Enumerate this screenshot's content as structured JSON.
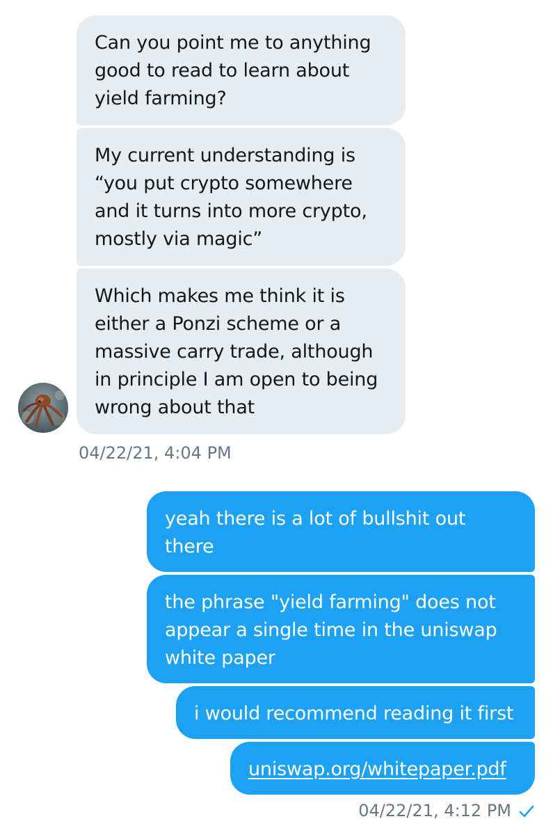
{
  "conversation": {
    "incoming": {
      "avatar_icon": "octopus-avatar",
      "messages": [
        {
          "lines": [
            "Can you point me to anything",
            "good to read to learn about",
            "yield farming?"
          ]
        },
        {
          "lines": [
            "My current understanding is",
            "“you put crypto somewhere",
            "and it turns into more crypto,",
            "mostly via magic”"
          ]
        },
        {
          "lines": [
            "Which makes me think it is",
            "either a Ponzi scheme or a",
            "massive carry trade, although",
            "in principle I am open to being",
            "wrong about that"
          ]
        }
      ],
      "timestamp": "04/22/21, 4:04 PM"
    },
    "outgoing": {
      "messages": [
        {
          "lines": [
            "yeah there is a lot of bullshit out",
            "there"
          ]
        },
        {
          "lines": [
            "the phrase \"yield farming\" does not",
            "appear a single time in the uniswap",
            "white paper"
          ]
        },
        {
          "lines": [
            "i would recommend reading it first"
          ]
        },
        {
          "link": "uniswap.org/whitepaper.pdf"
        }
      ],
      "timestamp": "04/22/21, 4:12 PM",
      "status_icon": "check-icon"
    }
  },
  "colors": {
    "incoming_bubble": "#e6ecf0",
    "outgoing_bubble": "#1da1f2",
    "timestamp": "#657786",
    "check": "#1da1f2"
  }
}
